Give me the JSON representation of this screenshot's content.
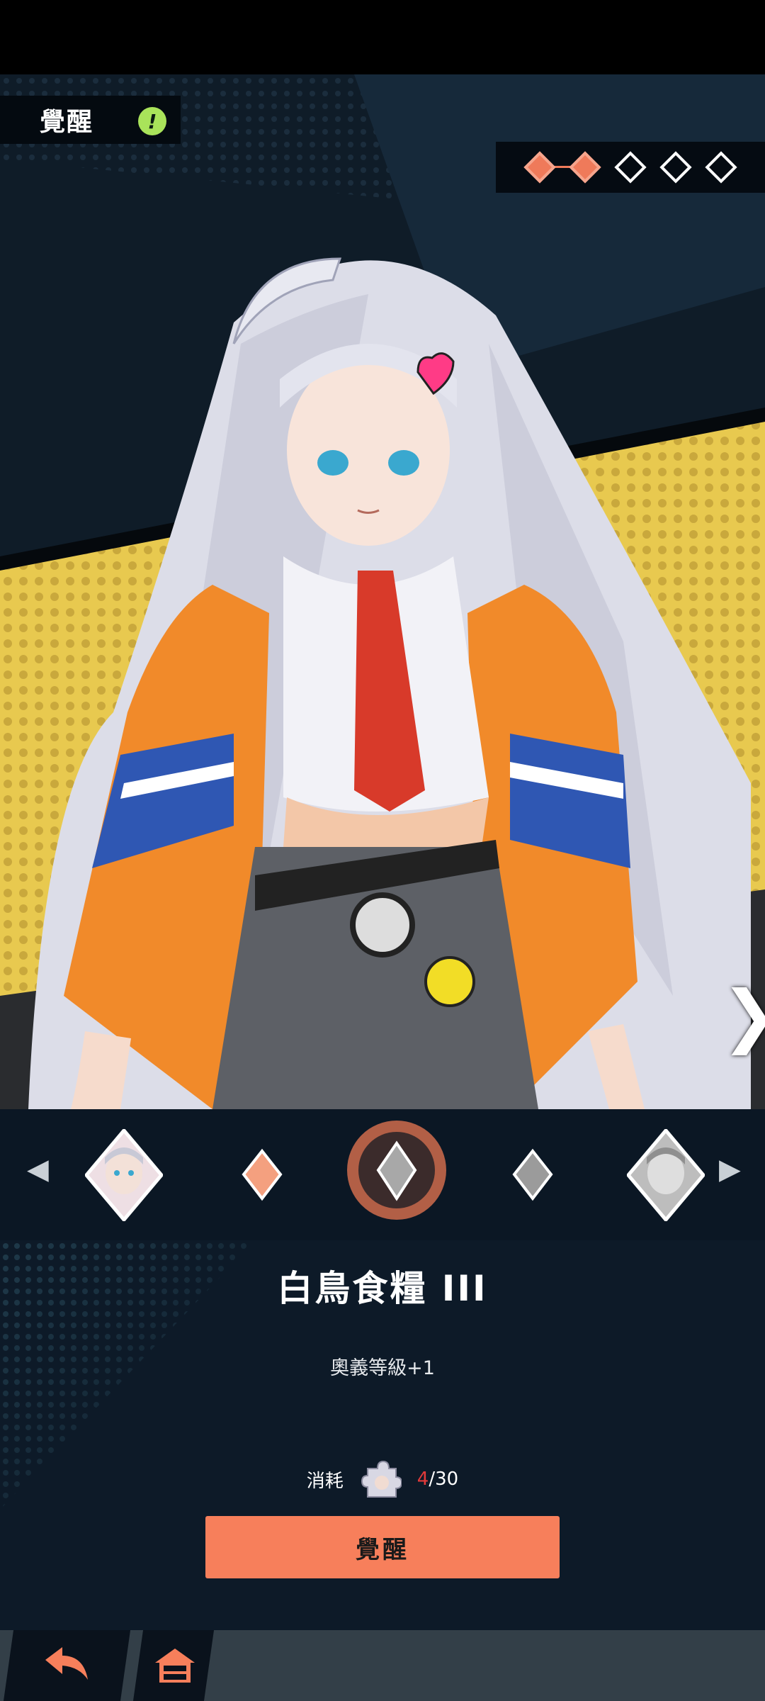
{
  "header": {
    "title": "覺醒",
    "alert_symbol": "!"
  },
  "awaken_stages": {
    "total": 5,
    "completed": 2
  },
  "character": {
    "description": "white-haired character portrait"
  },
  "selector": {
    "left_arrow": "‹",
    "right_arrow": "›",
    "nodes": [
      "character-card",
      "stage-orange",
      "stage-selected",
      "stage-grey",
      "character-card-grey"
    ]
  },
  "item": {
    "name": "白鳥食糧 III",
    "effect": "奧義等級+1",
    "cost_label": "消耗",
    "cost_have": "4",
    "cost_sep": "/",
    "cost_need": "30"
  },
  "actions": {
    "awaken_label": "覺醒"
  },
  "nav": {
    "back_icon": "back-arrow-icon",
    "home_icon": "home-icon"
  },
  "colors": {
    "accent": "#f77f5b",
    "alert": "#a9e35a",
    "bg_dark": "#0d1a28",
    "yellow_panel": "#e5c84f"
  }
}
